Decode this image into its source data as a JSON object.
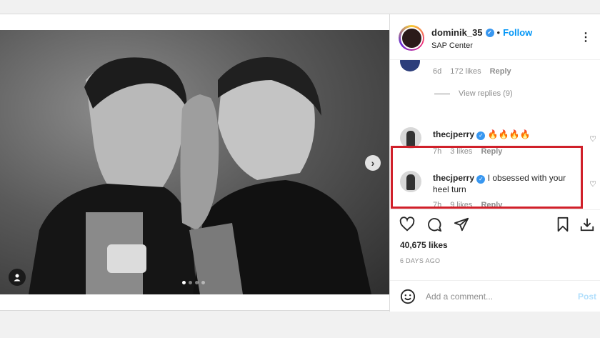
{
  "header": {
    "username": "dominik_35",
    "separator": "•",
    "follow_label": "Follow",
    "location": "SAP Center"
  },
  "previous_comment": {
    "age": "6d",
    "likes": "172 likes",
    "reply": "Reply"
  },
  "view_replies_label": "View replies (9)",
  "comments": [
    {
      "username": "thecjperry",
      "text": "🔥🔥🔥🔥",
      "age": "7h",
      "likes": "3 likes",
      "reply": "Reply"
    },
    {
      "username": "thecjperry",
      "text": "I obsessed with your heel turn",
      "age": "7h",
      "likes": "9 likes",
      "reply": "Reply"
    }
  ],
  "likes_count": "40,675 likes",
  "posted_ago": "6 DAYS AGO",
  "add_comment_placeholder": "Add a comment...",
  "post_label": "Post",
  "carousel": {
    "slides": 4,
    "active_index": 0
  },
  "colors": {
    "accent": "#0095f6",
    "highlight_border": "#d0202a",
    "verified": "#3897f0"
  },
  "icons": [
    "more-icon",
    "heart-icon",
    "comment-icon",
    "share-icon",
    "bookmark-icon",
    "download-icon",
    "emoji-icon",
    "next-arrow-icon",
    "user-tag-icon",
    "verified-icon"
  ]
}
